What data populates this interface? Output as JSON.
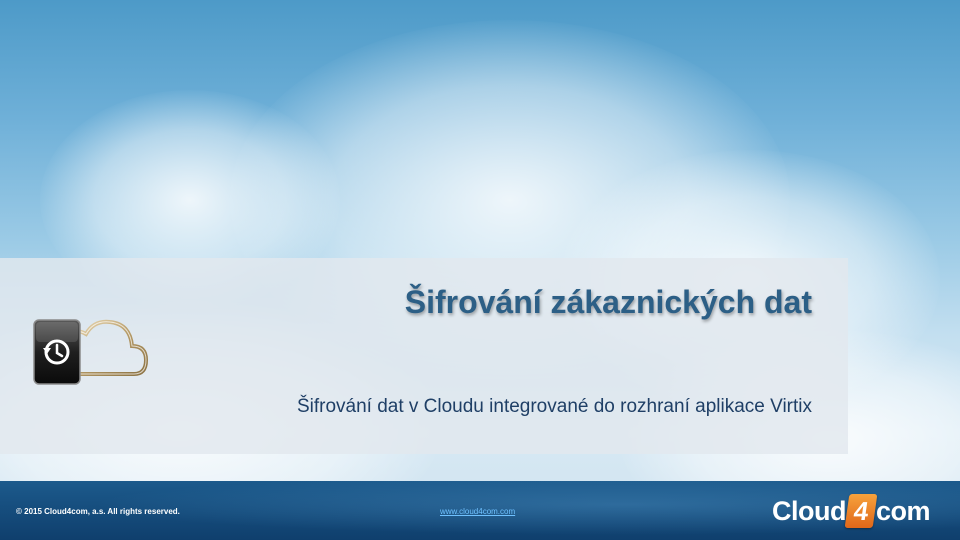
{
  "slide": {
    "title": "Šifrování zákaznických dat",
    "subtitle": "Šifrování dat v Cloudu integrované do rozhraní aplikace Virtix"
  },
  "footer": {
    "copyright": "© 2015 Cloud4com, a.s. All rights reserved.",
    "website": "www.cloud4com.com",
    "logo": {
      "prefix": "Cloud",
      "mark": "4",
      "suffix": "com"
    }
  },
  "icons": {
    "banner_icon": "cloud-backup-icon"
  },
  "colors": {
    "title": "#2c5f86",
    "subtitle": "#1f3f66",
    "footer": "#12456f",
    "logo_accent": "#e9801f",
    "link": "#6fc1ff"
  }
}
